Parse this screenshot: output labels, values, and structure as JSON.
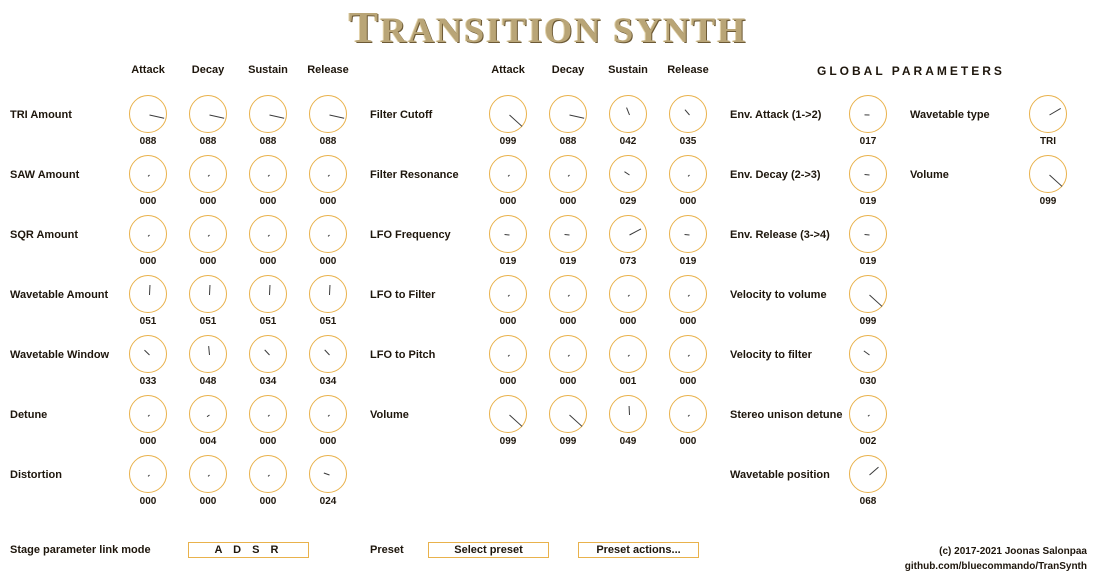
{
  "title": {
    "first": "T",
    "rest": "RANSITION SYNTH"
  },
  "stage_headers": [
    "Attack",
    "Decay",
    "Sustain",
    "Release"
  ],
  "global_header": "GLOBAL PARAMETERS",
  "left_rows": [
    {
      "label": "TRI Amount",
      "values": [
        "088",
        "088",
        "088",
        "088"
      ],
      "levels": [
        0.88,
        0.88,
        0.88,
        0.88
      ]
    },
    {
      "label": "SAW Amount",
      "values": [
        "000",
        "000",
        "000",
        "000"
      ],
      "levels": [
        0,
        0,
        0,
        0
      ]
    },
    {
      "label": "SQR Amount",
      "values": [
        "000",
        "000",
        "000",
        "000"
      ],
      "levels": [
        0,
        0,
        0,
        0
      ]
    },
    {
      "label": "Wavetable Amount",
      "values": [
        "051",
        "051",
        "051",
        "051"
      ],
      "levels": [
        0.51,
        0.51,
        0.51,
        0.51
      ]
    },
    {
      "label": "Wavetable Window",
      "values": [
        "033",
        "048",
        "034",
        "034"
      ],
      "levels": [
        0.33,
        0.48,
        0.34,
        0.34
      ]
    },
    {
      "label": "Detune",
      "values": [
        "000",
        "004",
        "000",
        "000"
      ],
      "levels": [
        0,
        0.04,
        0,
        0
      ]
    },
    {
      "label": "Distortion",
      "values": [
        "000",
        "000",
        "000",
        "024"
      ],
      "levels": [
        0,
        0,
        0,
        0.24
      ]
    }
  ],
  "mid_rows": [
    {
      "label": "Filter Cutoff",
      "values": [
        "099",
        "088",
        "042",
        "035"
      ],
      "levels": [
        0.99,
        0.88,
        0.42,
        0.35
      ]
    },
    {
      "label": "Filter Resonance",
      "values": [
        "000",
        "000",
        "029",
        "000"
      ],
      "levels": [
        0,
        0,
        0.29,
        0
      ]
    },
    {
      "label": "LFO Frequency",
      "values": [
        "019",
        "019",
        "073",
        "019"
      ],
      "levels": [
        0.19,
        0.19,
        0.73,
        0.19
      ]
    },
    {
      "label": "LFO to Filter",
      "values": [
        "000",
        "000",
        "000",
        "000"
      ],
      "levels": [
        0,
        0,
        0,
        0
      ]
    },
    {
      "label": "LFO to Pitch",
      "values": [
        "000",
        "000",
        "001",
        "000"
      ],
      "levels": [
        0,
        0,
        0.01,
        0
      ]
    },
    {
      "label": "Volume",
      "values": [
        "099",
        "099",
        "049",
        "000"
      ],
      "levels": [
        0.99,
        0.99,
        0.49,
        0
      ]
    }
  ],
  "global_left": [
    {
      "label": "Env. Attack (1->2)",
      "value": "017",
      "level": 0.17
    },
    {
      "label": "Env. Decay (2->3)",
      "value": "019",
      "level": 0.19
    },
    {
      "label": "Env. Release (3->4)",
      "value": "019",
      "level": 0.19
    },
    {
      "label": "Velocity to volume",
      "value": "099",
      "level": 0.99
    },
    {
      "label": "Velocity to filter",
      "value": "030",
      "level": 0.3
    },
    {
      "label": "Stereo unison detune",
      "value": "002",
      "level": 0.02
    },
    {
      "label": "Wavetable position",
      "value": "068",
      "level": 0.68
    }
  ],
  "global_right": [
    {
      "label": "Wavetable type",
      "value": "TRI",
      "level": 0.72
    },
    {
      "label": "Volume",
      "value": "099",
      "level": 0.99
    }
  ],
  "bottom": {
    "link_mode_label": "Stage parameter link mode",
    "link_mode_value": "A D S R",
    "preset_label": "Preset",
    "preset_select": "Select preset",
    "preset_actions": "Preset actions...",
    "copyright_line1": "(c) 2017-2021 Joonas Salonpaa",
    "copyright_line2": "github.com/bluecommando/TranSynth"
  },
  "colors": {
    "knob_border": "#e9b24c",
    "title": "#b9a577",
    "text": "#1e160c"
  }
}
